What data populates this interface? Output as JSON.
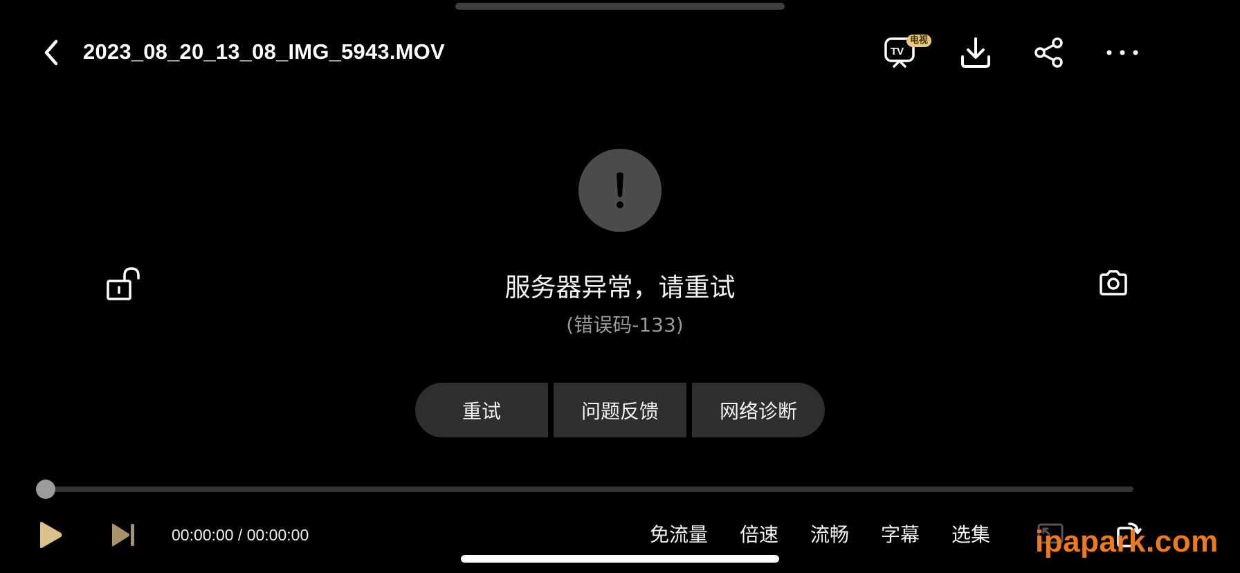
{
  "header": {
    "title": "2023_08_20_13_08_IMG_5943.MOV",
    "tv_badge": "电视",
    "icons": [
      "back-icon",
      "tv-cast-icon",
      "download-icon",
      "share-icon",
      "more-icon"
    ]
  },
  "error": {
    "message": "服务器异常，请重试",
    "code": "(错误码-133)",
    "icon": "exclamation-icon"
  },
  "side": {
    "lock_icon": "unlock-icon",
    "camera_icon": "camera-icon"
  },
  "actions": {
    "retry": "重试",
    "feedback": "问题反馈",
    "diagnose": "网络诊断"
  },
  "player": {
    "progress": 0,
    "time": "00:00:00 / 00:00:00",
    "controls": {
      "free_data": "免流量",
      "speed": "倍速",
      "quality": "流畅",
      "subtitle": "字幕",
      "episodes": "选集"
    }
  },
  "watermark": "ipapark.com",
  "colors": {
    "background": "#000000",
    "badge": "#e9c77c",
    "button": "#2e2e2e",
    "watermark": "#f07a1a"
  }
}
